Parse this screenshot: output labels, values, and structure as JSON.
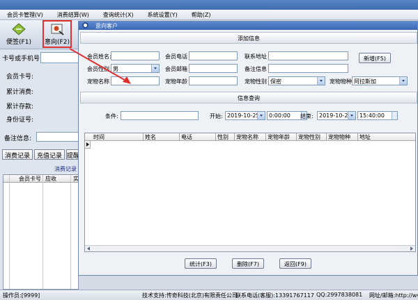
{
  "menu": [
    "会员卡管理(V)",
    "消费结算(W)",
    "查询统计(X)",
    "系统设置(Y)",
    "帮助(Z)"
  ],
  "toolbar": {
    "note_label": "便签(F1)",
    "intent_label": "意向(F2)"
  },
  "left_panel": {
    "search_label": "卡号或手机号",
    "card_label": "会员卡号:",
    "consume_label": "累计消费:",
    "recharge_label": "累计存款:",
    "id_label": "身份证号:",
    "memo_label": "备注信息:",
    "buttons": [
      "消费记录",
      "充值记录",
      "提醒"
    ],
    "consume_records_label": "消费记录",
    "grid_columns": [
      "会员卡号",
      "应收",
      "实"
    ]
  },
  "dialog": {
    "title": "意向客户",
    "add_section": "添加信息",
    "query_section": "信息查询",
    "fields": {
      "member_name": "会员姓名:",
      "member_phone": "会员电话",
      "address": "联系地址",
      "member_gender": "会员性别",
      "member_email": "会员邮箱",
      "remark": "备注信息",
      "pet_name": "宠物名称",
      "pet_age": "宠物年龄",
      "pet_gender": "宠物性别",
      "pet_breed": "宠物物种"
    },
    "values": {
      "gender": "男",
      "pet_gender": "保密",
      "pet_breed": "阿拉斯加"
    },
    "add_button": "新增(F5)",
    "query": {
      "condition_label": "条件:",
      "start_label": "开始:",
      "end_label": "结束:",
      "start_date": "2019-10-25",
      "start_time": "0:00:00",
      "end_date": "2019-10-25",
      "end_time": "15:40:00"
    },
    "grid_columns": [
      "时间",
      "姓名",
      "电话",
      "性别",
      "宠物名称",
      "宠物年龄",
      "宠物性别",
      "宠物物种",
      "地址"
    ],
    "buttons": {
      "stats": "统计(F3)",
      "delete": "删除(F7)",
      "back": "返回(F9)"
    }
  },
  "status": {
    "operator": "操作员:[9999]",
    "support": "技术支持:传奇科技(北京)有限责任公司",
    "phone": "联系电话(客服):13391767117",
    "qq": "QQ:2997838081",
    "site": "网址/邮箱:http://www.rc"
  },
  "colors": {
    "title_bar": "#3f6cb0",
    "highlight": "#e03030",
    "label_blue": "#1a2a8a"
  }
}
